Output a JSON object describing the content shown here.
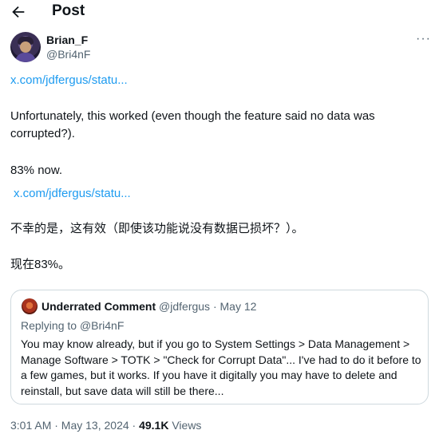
{
  "header": {
    "title": "Post",
    "back_icon": "arrow-left-icon"
  },
  "author": {
    "name": "Brian_F",
    "handle": "@Bri4nF"
  },
  "menu": {
    "more_label": "···"
  },
  "post": {
    "link1": "x.com/jdfergus/statu...",
    "para1": "Unfortunately, this worked (even though the feature said no data was corrupted?).",
    "para2": "83% now.",
    "link2": "x.com/jdfergus/statu...",
    "para3": "不幸的是，这有效（即使该功能说没有数据已损坏？）。",
    "para4": "现在83%。"
  },
  "quote": {
    "name": "Underrated Comment",
    "handle": "@jdfergus",
    "separator": " · ",
    "date": "May 12",
    "replying_prefix": "Replying to ",
    "replying_to": "@Bri4nF",
    "body": "You may know already, but if you go to System Settings > Data Management > Manage Software > TOTK > \"Check for Corrupt Data\"... I've had to do it before to a few games, but it works. If you have it digitally you may have to delete and reinstall, but save data will still be there..."
  },
  "meta": {
    "time": "3:01 AM · May 13, 2024 · ",
    "views_count": "49.1K",
    "views_label": " Views"
  },
  "colors": {
    "link": "#1d9bf0",
    "secondary_text": "#536471",
    "border": "#cfd9de"
  }
}
